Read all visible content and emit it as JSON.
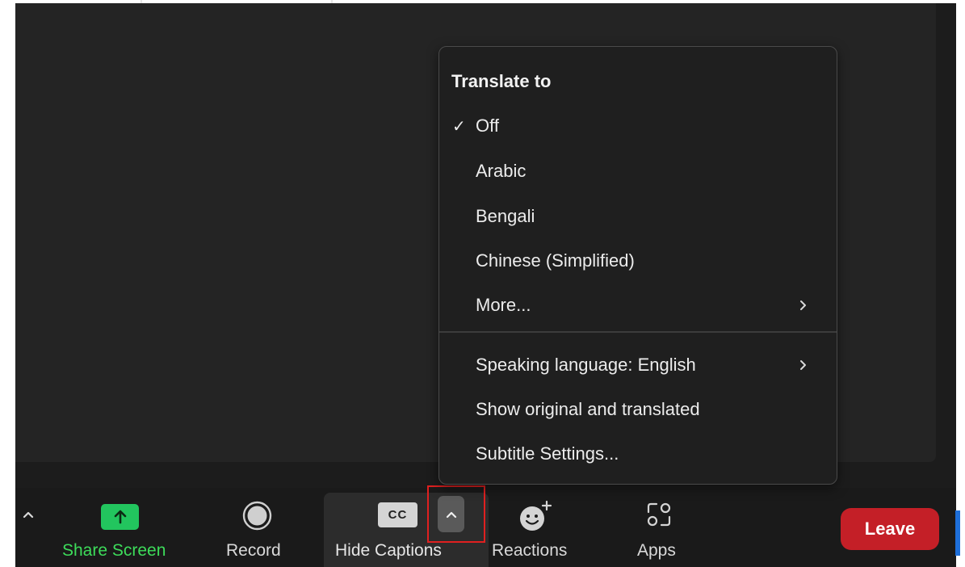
{
  "toolbar": {
    "share_label": "Share Screen",
    "record_label": "Record",
    "captions_label": "Hide Captions",
    "cc_text": "CC",
    "reactions_label": "Reactions",
    "apps_label": "Apps",
    "leave_label": "Leave"
  },
  "menu": {
    "heading": "Translate to",
    "check_glyph": "✓",
    "languages": [
      {
        "label": "Off",
        "checked": true
      },
      {
        "label": "Arabic",
        "checked": false
      },
      {
        "label": "Bengali",
        "checked": false
      },
      {
        "label": "Chinese (Simplified)",
        "checked": false
      },
      {
        "label": "More...",
        "submenu": true
      }
    ],
    "settings": [
      {
        "label": "Speaking language: English",
        "submenu": true
      },
      {
        "label": "Show original and translated"
      },
      {
        "label": "Subtitle Settings..."
      }
    ]
  },
  "colors": {
    "share_green": "#22c55e",
    "leave_red": "#c41f27",
    "highlight_red": "#e02020"
  },
  "icons": {
    "toolbar_caret": "chevron-up-icon",
    "share": "arrow-up-icon",
    "record": "record-circle-icon",
    "captions_arrow": "chevron-up-icon",
    "reactions": "smiley-plus-icon",
    "apps": "apps-icon",
    "submenu": "chevron-right-icon"
  }
}
